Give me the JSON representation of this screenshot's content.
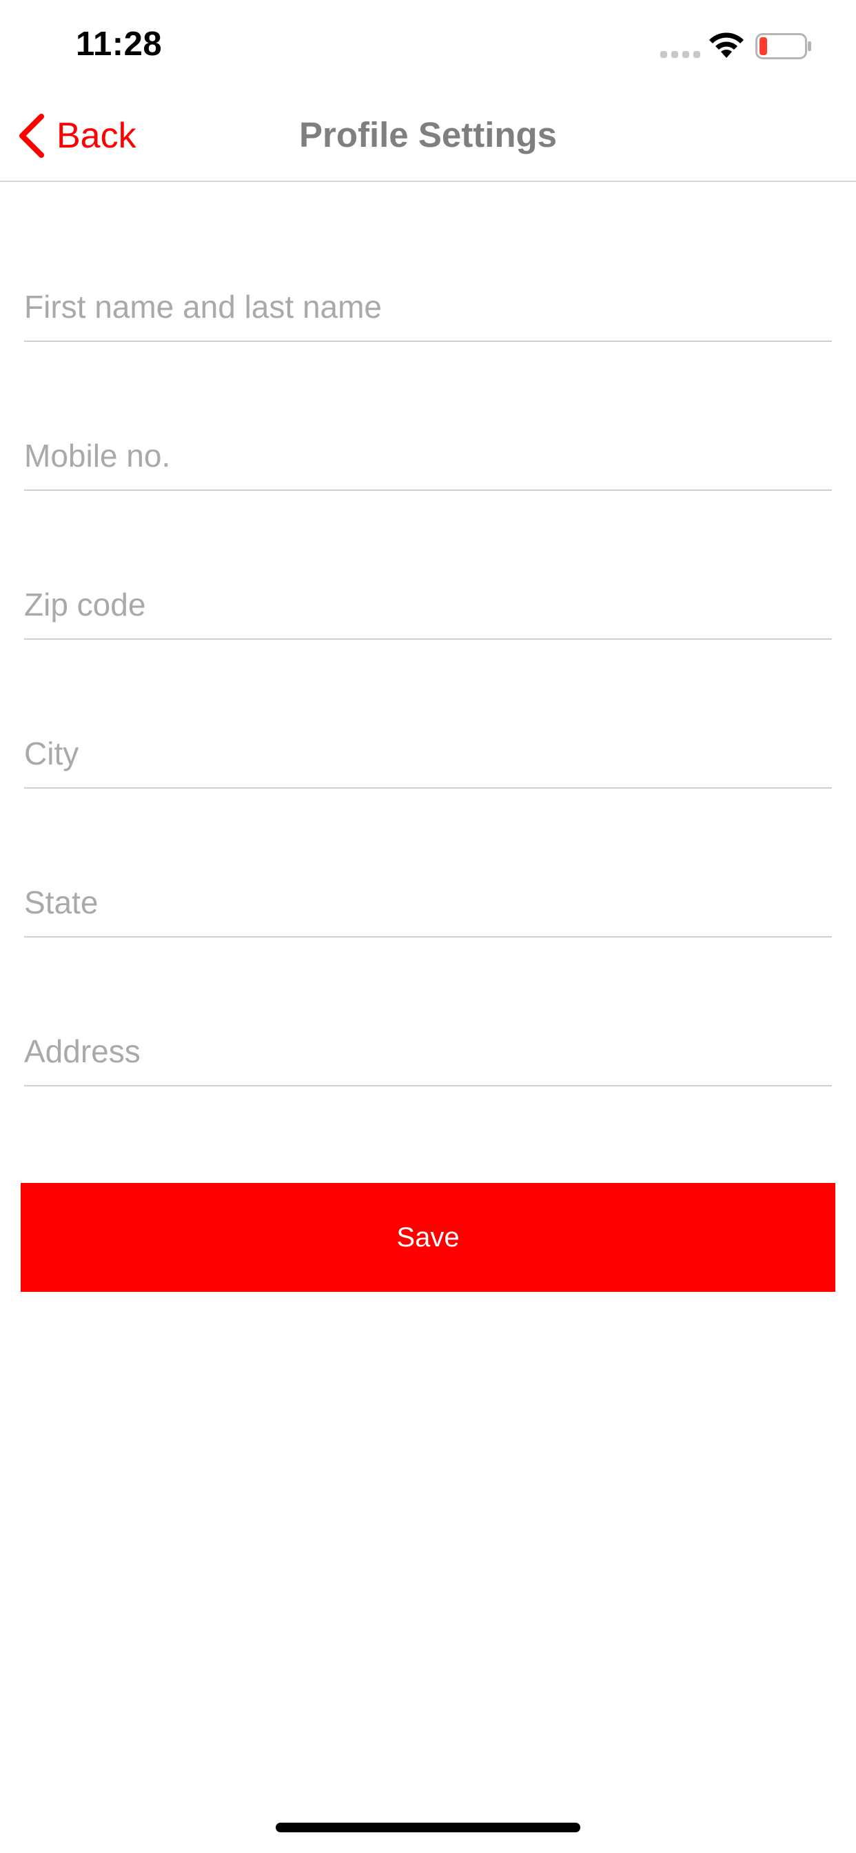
{
  "status_bar": {
    "time": "11:28",
    "icons": [
      "signal-icon",
      "wifi-icon",
      "battery-low-icon"
    ]
  },
  "nav": {
    "back_label": "Back",
    "title": "Profile Settings",
    "back_icon": "chevron-left-icon"
  },
  "form": {
    "fields": [
      {
        "placeholder": "First name and last name",
        "value": ""
      },
      {
        "placeholder": "Mobile no.",
        "value": ""
      },
      {
        "placeholder": "Zip code",
        "value": ""
      },
      {
        "placeholder": "City",
        "value": ""
      },
      {
        "placeholder": "State",
        "value": ""
      },
      {
        "placeholder": "Address",
        "value": ""
      }
    ],
    "save_label": "Save"
  },
  "colors": {
    "accent": "#ff0000",
    "title_gray": "#7f7f7f",
    "placeholder_gray": "#a9a9a9",
    "divider": "#cfcfcf"
  }
}
